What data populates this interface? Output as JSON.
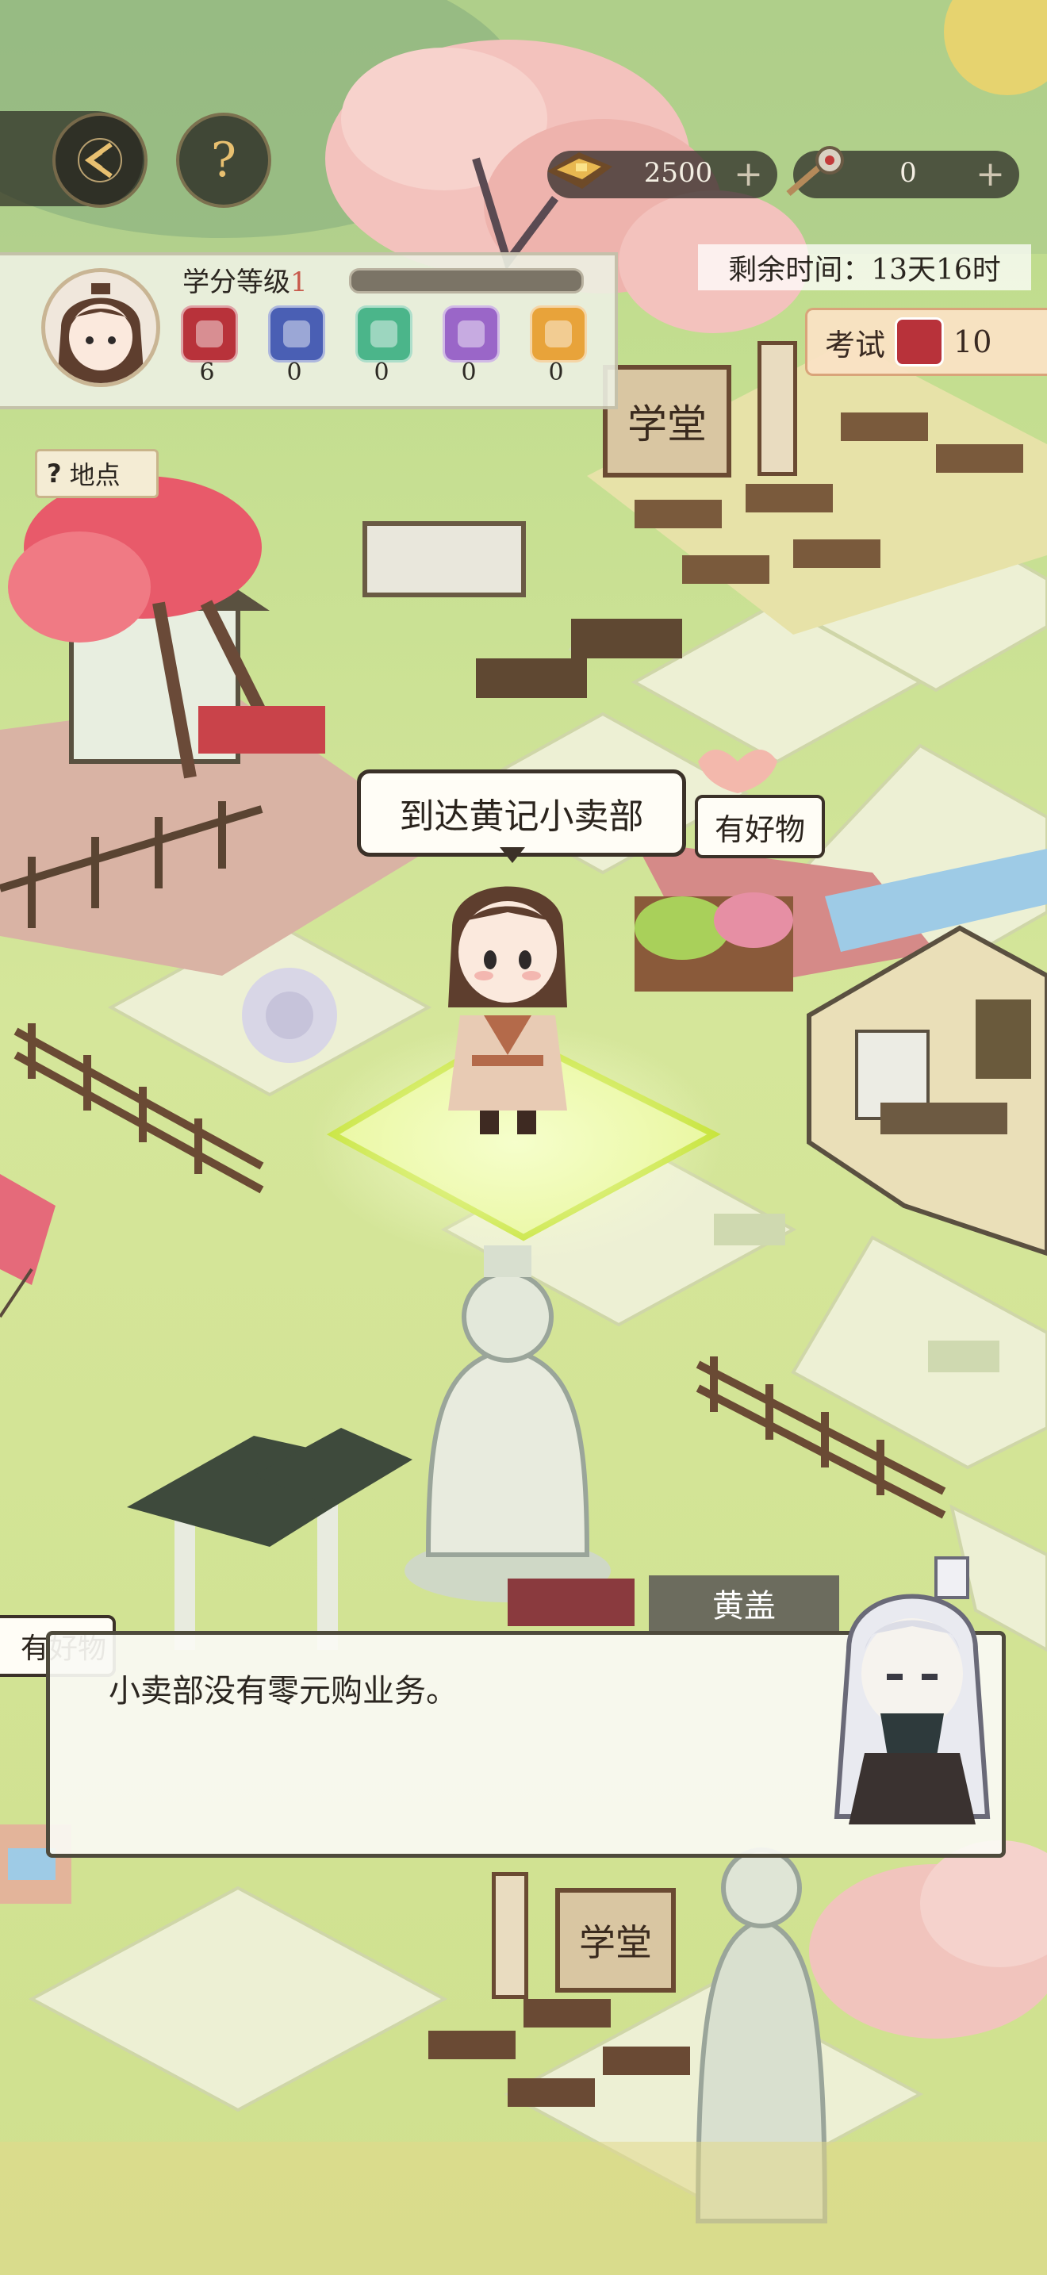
{
  "hud": {
    "back_icon": "double-chevron-left-icon",
    "help_label": "?",
    "coins": {
      "icon": "gold-ingot-icon",
      "value": "2500",
      "plus": "+"
    },
    "tools": {
      "icon": "magnifier-key-icon",
      "value": "0",
      "plus": "+"
    }
  },
  "player": {
    "credit_label": "学分等级",
    "credit_level": "1",
    "credit_progress": 0,
    "badges": [
      {
        "icon": "red-book-icon",
        "color": "#b8323a",
        "count": "6"
      },
      {
        "icon": "blue-fish-icon",
        "color": "#4a5fb4",
        "count": "0"
      },
      {
        "icon": "green-gem-icon",
        "color": "#4bb58a",
        "count": "0"
      },
      {
        "icon": "purple-leaf-icon",
        "color": "#9a66c8",
        "count": "0"
      },
      {
        "icon": "orange-brush-icon",
        "color": "#e8a33a",
        "count": "0"
      }
    ]
  },
  "time_remaining": "剩余时间：13天16时",
  "exam": {
    "label": "考试",
    "count": "10"
  },
  "location_tag": {
    "q": "?",
    "label": "地点"
  },
  "map": {
    "school_sign_top": "学堂",
    "school_sign_bottom": "学堂"
  },
  "speech": {
    "arrive": "到达黄记小卖部",
    "goods": "有好物",
    "goods_partial": "有好物"
  },
  "dialog": {
    "speaker": "黄盖",
    "text": "小卖部没有零元购业务。"
  },
  "colors": {
    "grass": "#c9df8e",
    "tile": "#eef0d8",
    "highlight": "#dff56b",
    "dialog_border": "#4e4a3c"
  }
}
